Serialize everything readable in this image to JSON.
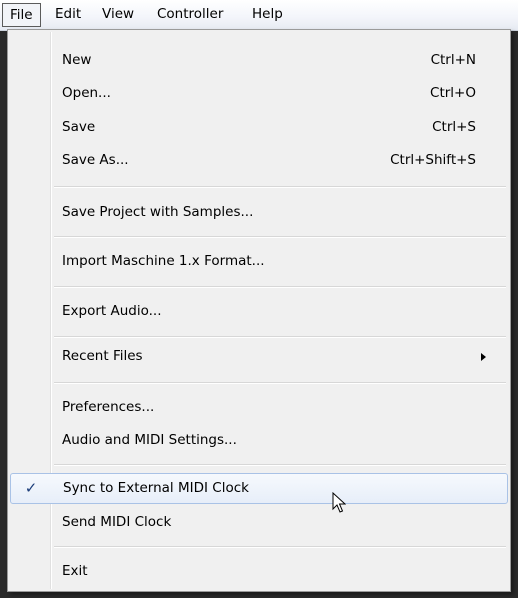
{
  "menubar": {
    "items": [
      {
        "label": "File"
      },
      {
        "label": "Edit"
      },
      {
        "label": "View"
      },
      {
        "label": "Controller"
      },
      {
        "label": "Help"
      }
    ]
  },
  "file_menu": {
    "items": [
      {
        "label": "New",
        "shortcut": "Ctrl+N"
      },
      {
        "label": "Open...",
        "shortcut": "Ctrl+O"
      },
      {
        "label": "Save",
        "shortcut": "Ctrl+S"
      },
      {
        "label": "Save As...",
        "shortcut": "Ctrl+Shift+S"
      },
      {
        "label": "Save Project with Samples..."
      },
      {
        "label": "Import Maschine 1.x Format..."
      },
      {
        "label": "Export Audio..."
      },
      {
        "label": "Recent Files",
        "submenu": true
      },
      {
        "label": "Preferences..."
      },
      {
        "label": "Audio and MIDI Settings..."
      },
      {
        "label": "Sync to External MIDI Clock",
        "checked": true,
        "checkmark": "✓",
        "highlighted": true
      },
      {
        "label": "Send MIDI Clock"
      },
      {
        "label": "Exit"
      }
    ]
  },
  "colors": {
    "highlight_border": "#a9c2e6",
    "menu_background": "#f0f0f0"
  }
}
